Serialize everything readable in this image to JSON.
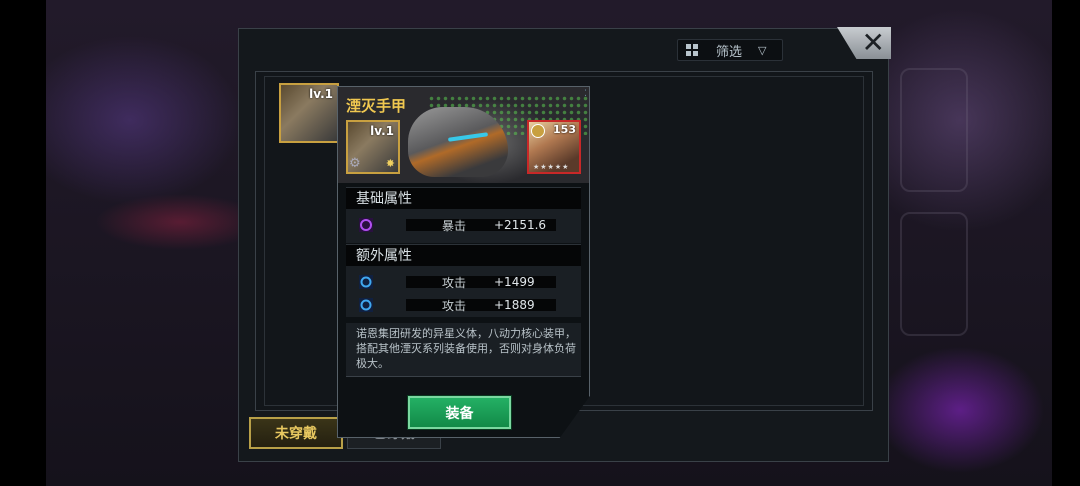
{
  "filter": {
    "label": "筛选",
    "icon": "grid-icon",
    "dropdown_icon": "triangle-down-icon",
    "dropdown_glyph": "▽"
  },
  "close": {
    "icon": "close-icon",
    "glyph": "✕"
  },
  "inventory": {
    "items": [
      {
        "level": "lv.1",
        "icon": "gauntlet-icon"
      }
    ],
    "tabs": [
      {
        "label": "未穿戴",
        "active": true
      },
      {
        "label": "已穿戴",
        "active": false
      }
    ]
  },
  "card": {
    "title": "湮灭手甲",
    "item_level": "lv.1",
    "hero_level": "153",
    "base_header": "基础属性",
    "base_attrs": [
      {
        "name": "暴击",
        "value": "+2151.6",
        "icon": "crit-icon",
        "color": "#a040e0"
      }
    ],
    "extra_header": "额外属性",
    "extra_attrs": [
      {
        "name": "攻击",
        "value": "+1499",
        "icon": "attack-icon",
        "color": "#40a0f0"
      },
      {
        "name": "攻击",
        "value": "+1889",
        "icon": "attack-icon",
        "color": "#40a0f0"
      }
    ],
    "description": "诺恩集团研发的异星义体，八动力核心装甲，搭配其他湮灭系列装备使用，否则对身体负荷极大。",
    "equip_label": "装备"
  },
  "colors": {
    "title": "#f0c850",
    "equip_button": "#1a9a54",
    "hero_border": "#c82828",
    "item_border": "#c8a040"
  }
}
